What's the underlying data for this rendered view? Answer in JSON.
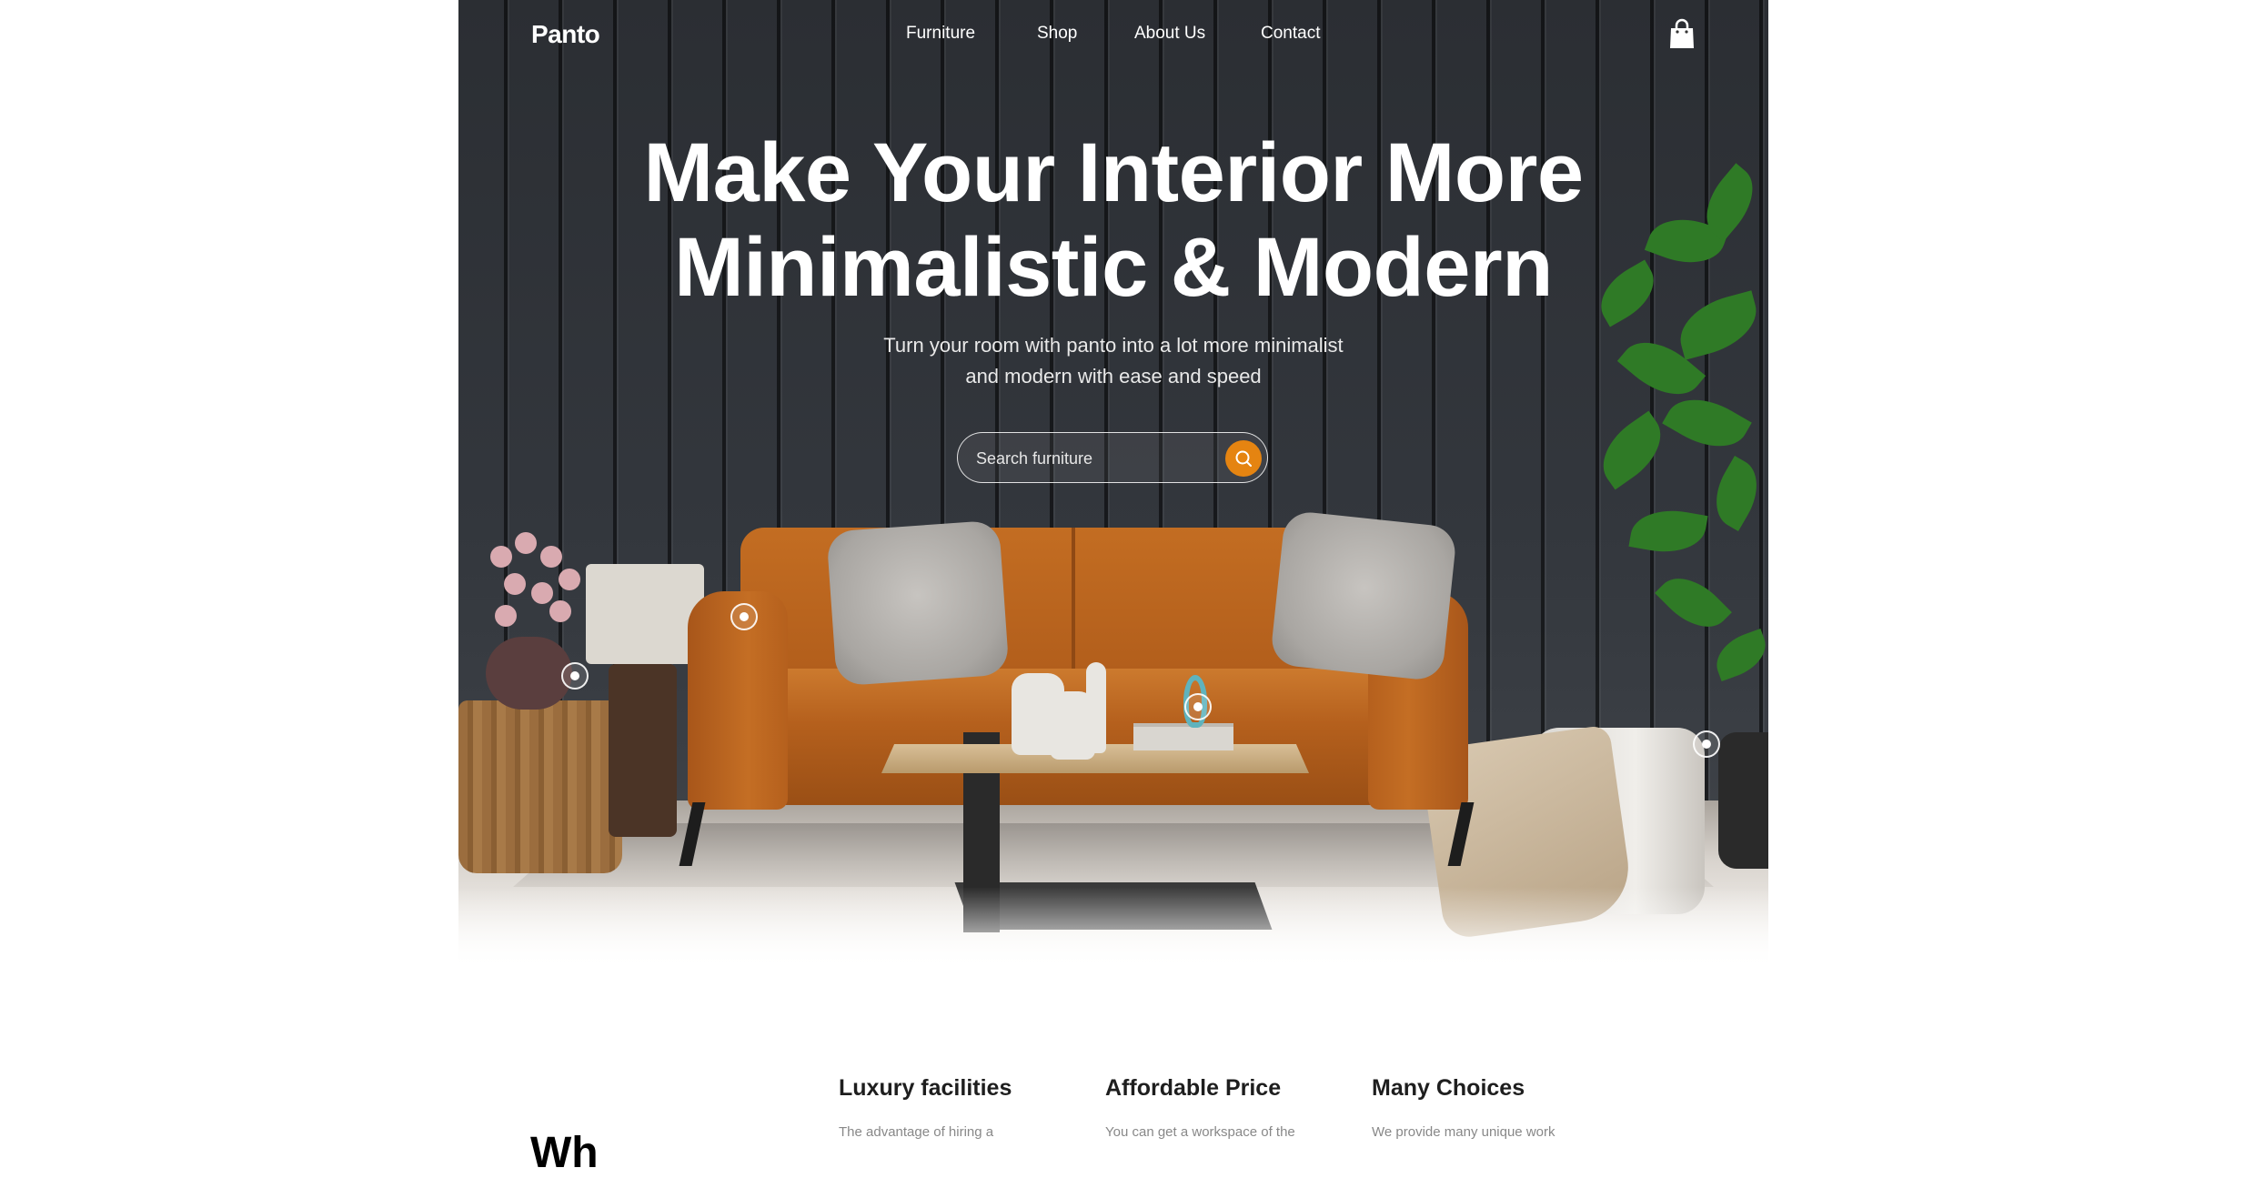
{
  "header": {
    "logo": "Panto",
    "nav": [
      "Furniture",
      "Shop",
      "About Us",
      "Contact"
    ]
  },
  "hero": {
    "headline_line1": "Make Your Interior More",
    "headline_line2": "Minimalistic & Modern",
    "subtitle_line1": "Turn your room with panto into a lot more minimalist",
    "subtitle_line2": "and modern with ease and speed",
    "search": {
      "placeholder": "Search furniture"
    }
  },
  "features": {
    "section_title_partial": "Wh",
    "items": [
      {
        "title": "Luxury facilities",
        "text_partial": "The advantage of hiring a"
      },
      {
        "title": "Affordable Price",
        "text_partial": "You can get a workspace of the"
      },
      {
        "title": "Many Choices",
        "text_partial": "We provide many unique work"
      }
    ]
  },
  "colors": {
    "accent": "#e58411",
    "hero_wall": "#2b2e33",
    "sofa": "#c36d22",
    "text_dark": "#1e1e1e"
  },
  "icons": {
    "cart": "shopping-bag-icon",
    "search": "search-icon",
    "hotspot": "hotspot-icon"
  }
}
